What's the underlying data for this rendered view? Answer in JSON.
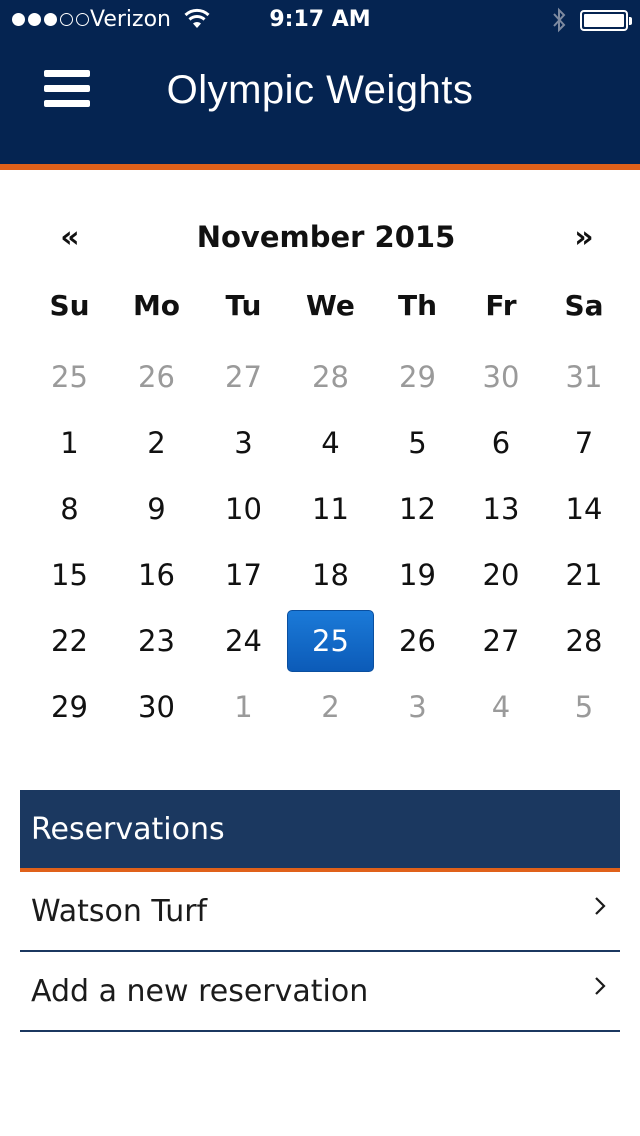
{
  "status_bar": {
    "carrier": "Verizon",
    "time": "9:17 AM",
    "signal_strength": 3,
    "signal_max": 5,
    "battery_level": 1.0
  },
  "nav": {
    "title": "Olympic Weights",
    "menu_icon": "hamburger-icon"
  },
  "calendar": {
    "prev_label": "«",
    "next_label": "»",
    "month_label": "November 2015",
    "weekdays": [
      "Su",
      "Mo",
      "Tu",
      "We",
      "Th",
      "Fr",
      "Sa"
    ],
    "selected_day": "25",
    "weeks": [
      [
        {
          "d": "25",
          "m": true
        },
        {
          "d": "26",
          "m": true
        },
        {
          "d": "27",
          "m": true
        },
        {
          "d": "28",
          "m": true
        },
        {
          "d": "29",
          "m": true
        },
        {
          "d": "30",
          "m": true
        },
        {
          "d": "31",
          "m": true
        }
      ],
      [
        {
          "d": "1"
        },
        {
          "d": "2"
        },
        {
          "d": "3"
        },
        {
          "d": "4"
        },
        {
          "d": "5"
        },
        {
          "d": "6"
        },
        {
          "d": "7"
        }
      ],
      [
        {
          "d": "8"
        },
        {
          "d": "9"
        },
        {
          "d": "10"
        },
        {
          "d": "11"
        },
        {
          "d": "12"
        },
        {
          "d": "13"
        },
        {
          "d": "14"
        }
      ],
      [
        {
          "d": "15"
        },
        {
          "d": "16"
        },
        {
          "d": "17"
        },
        {
          "d": "18"
        },
        {
          "d": "19"
        },
        {
          "d": "20"
        },
        {
          "d": "21"
        }
      ],
      [
        {
          "d": "22"
        },
        {
          "d": "23"
        },
        {
          "d": "24"
        },
        {
          "d": "25",
          "s": true
        },
        {
          "d": "26"
        },
        {
          "d": "27"
        },
        {
          "d": "28"
        }
      ],
      [
        {
          "d": "29"
        },
        {
          "d": "30"
        },
        {
          "d": "1",
          "m": true
        },
        {
          "d": "2",
          "m": true
        },
        {
          "d": "3",
          "m": true
        },
        {
          "d": "4",
          "m": true
        },
        {
          "d": "5",
          "m": true
        }
      ]
    ]
  },
  "reservations": {
    "header": "Reservations",
    "items": [
      {
        "label": "Watson Turf"
      },
      {
        "label": "Add a new reservation"
      }
    ]
  },
  "colors": {
    "header_bg": "#052451",
    "accent_orange": "#e0611a",
    "panel_bg": "#1b3860",
    "selected_blue": "#1b7ad8",
    "muted_text": "#9a9a9a"
  }
}
